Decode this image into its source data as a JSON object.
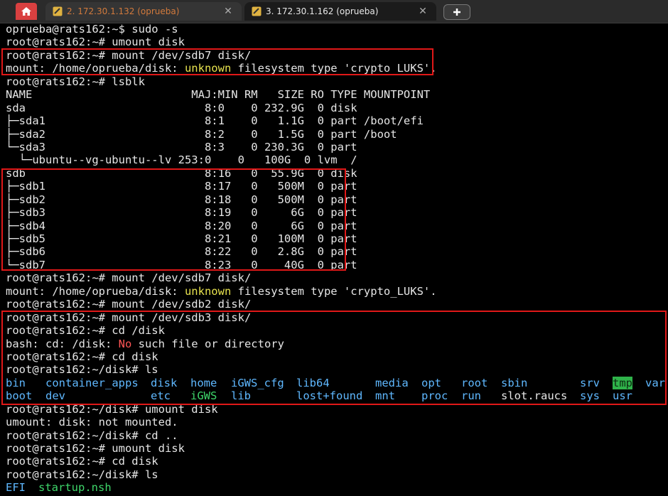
{
  "tabs": {
    "home_icon": "home-icon",
    "items": [
      {
        "label": "2. 172.30.1.132 (oprueba)",
        "close": "✕"
      },
      {
        "label": "3. 172.30.1.162 (oprueba)",
        "close": "✕"
      }
    ],
    "new_tab_icon": "plus-icon"
  },
  "colors": {
    "accent_box": "#e01818",
    "dir_blue": "#5fb8ff",
    "exec_green": "#3ed66a",
    "warn_yellow": "#e7e24e",
    "err_red": "#ff5555"
  },
  "terminal": {
    "l1": "oprueba@rats162:~$ sudo -s",
    "l2": "root@rats162:~# umount disk",
    "l3": "root@rats162:~# mount /dev/sdb7 disk/",
    "l4a": "mount: /home/oprueba/disk: ",
    "l4b": "unknown",
    "l4c": " filesystem type 'crypto_LUKS'.",
    "l5": "root@rats162:~# lsblk",
    "lsblk": [
      "NAME                        MAJ:MIN RM   SIZE RO TYPE MOUNTPOINT",
      "sda                           8:0    0 232.9G  0 disk",
      "├─sda1                        8:1    0   1.1G  0 part /boot/efi",
      "├─sda2                        8:2    0   1.5G  0 part /boot",
      "└─sda3                        8:3    0 230.3G  0 part",
      "  └─ubuntu--vg-ubuntu--lv 253:0    0   100G  0 lvm  /",
      "sdb                           8:16   0  55.9G  0 disk",
      "├─sdb1                        8:17   0   500M  0 part",
      "├─sdb2                        8:18   0   500M  0 part",
      "├─sdb3                        8:19   0     6G  0 part",
      "├─sdb4                        8:20   0     6G  0 part",
      "├─sdb5                        8:21   0   100M  0 part",
      "├─sdb6                        8:22   0   2.8G  0 part",
      "└─sdb7                        8:23   0    40G  0 part"
    ],
    "l6": "root@rats162:~# mount /dev/sdb7 disk/",
    "l7a": "mount: /home/oprueba/disk: ",
    "l7b": "unknown",
    "l7c": " filesystem type 'crypto_LUKS'.",
    "l8": "root@rats162:~# mount /dev/sdb2 disk/",
    "l9": "root@rats162:~# mount /dev/sdb3 disk/",
    "l10": "root@rats162:~# cd /disk",
    "l11a": "bash: cd: /disk: ",
    "l11b": "No",
    "l11c": " such file or directory",
    "l12": "root@rats162:~# cd disk",
    "l13": "root@rats162:~/disk# ls",
    "ls1": [
      "bin",
      "container_apps",
      "disk",
      "home",
      "iGWS_cfg",
      "lib64",
      "media",
      "opt",
      "root",
      "sbin",
      "srv",
      "tmp",
      "var"
    ],
    "ls2": [
      "boot",
      "dev",
      "etc",
      "iGWS",
      "lib",
      "lost+found",
      "mnt",
      "proc",
      "run",
      "slot.raucs",
      "sys",
      "usr"
    ],
    "l14": "root@rats162:~/disk# umount disk",
    "l15": "umount: disk: not mounted.",
    "l16": "root@rats162:~/disk# cd ..",
    "l17": "root@rats162:~# umount disk",
    "l18": "root@rats162:~# cd disk",
    "l19": "root@rats162:~/disk# ls",
    "ls3": [
      "EFI",
      "startup.nsh"
    ]
  }
}
